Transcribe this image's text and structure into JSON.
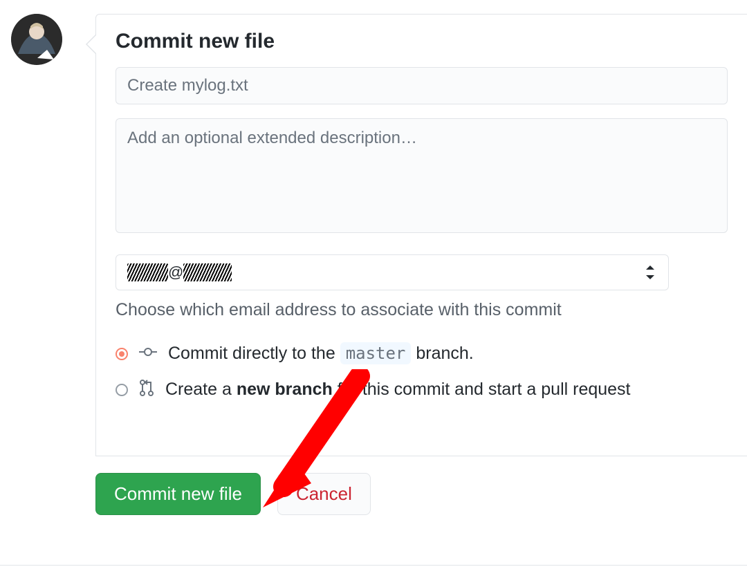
{
  "panel": {
    "title": "Commit new file",
    "subject_placeholder": "Create mylog.txt",
    "description_placeholder": "Add an optional extended description…",
    "email": {
      "selected_display_left": "xxxxx",
      "selected_display_right": "xxxxxx",
      "help_text": "Choose which email address to associate with this commit"
    },
    "radios": {
      "direct_prefix": "Commit directly to the ",
      "direct_branch": "master",
      "direct_suffix": " branch.",
      "new_branch_prefix": "Create a ",
      "new_branch_strong": "new branch",
      "new_branch_suffix": " for this commit and start a pull request"
    }
  },
  "actions": {
    "commit_label": "Commit new file",
    "cancel_label": "Cancel"
  },
  "colors": {
    "primary_button": "#2ea44f",
    "danger_text": "#cb2431",
    "annotation_arrow": "#ff0000"
  }
}
